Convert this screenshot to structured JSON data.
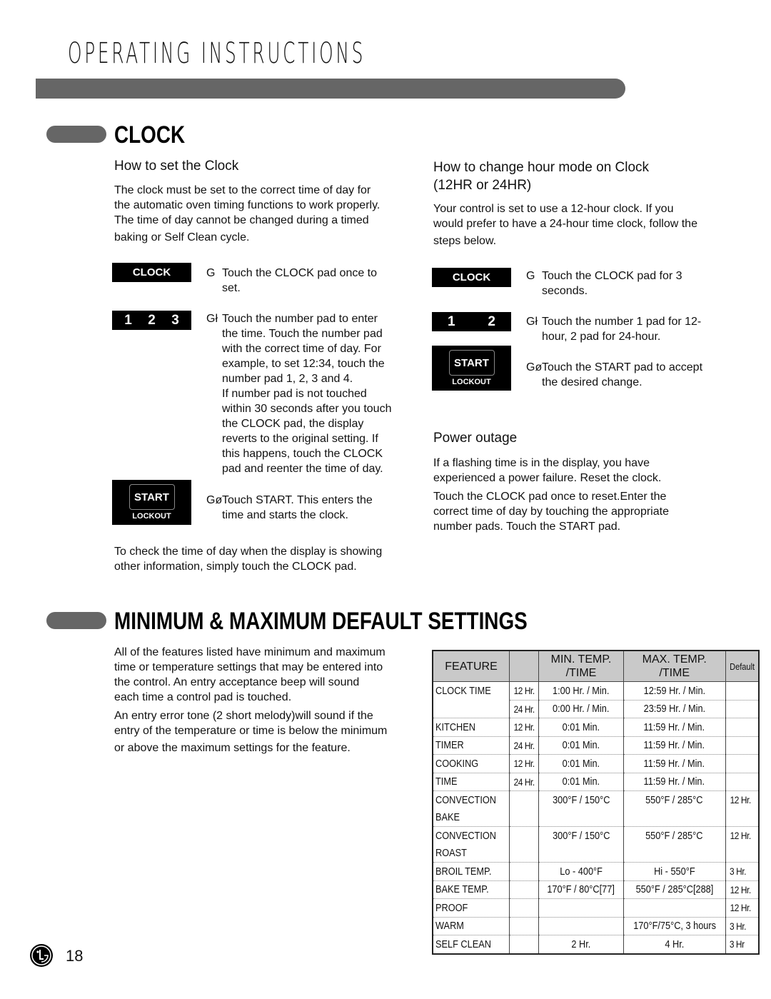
{
  "header": {
    "title": "OPERATING INSTRUCTIONS"
  },
  "clock_section": {
    "title": "CLOCK",
    "set_clock": {
      "heading": "How to set the Clock",
      "intro": [
        "The clock must be set to the correct time of day for",
        "the automatic oven timing functions to work properly.",
        "The time of day cannot be changed during a timed",
        "baking or Self Clean cycle."
      ],
      "pads": {
        "clock": "CLOCK",
        "numbers": [
          "1",
          "2",
          "3"
        ],
        "start": "START",
        "lockout": "LOCKOUT"
      },
      "steps": [
        {
          "marker": "G",
          "lines": [
            "Touch the CLOCK pad once to",
            "set."
          ]
        },
        {
          "marker": "Gł",
          "lines": [
            "Touch the number  pad to enter",
            "the time. Touch the number pad",
            "with the correct time of day. For",
            "example, to set 12:34, touch the",
            "number pad 1, 2, 3 and 4.",
            "If number pad is not touched",
            "within 30 seconds after you touch",
            "the CLOCK pad, the display",
            "reverts to the original setting. If",
            "this happens, touch the CLOCK",
            "pad and reenter the time of day."
          ]
        },
        {
          "marker": "Gø",
          "lines": [
            "Touch START. This enters the",
            "time and starts the clock."
          ]
        }
      ],
      "footer": [
        "To check the time of day when the display is showing",
        "other information, simply touch the CLOCK pad."
      ]
    },
    "hour_mode": {
      "heading_lines": [
        "How to change hour mode on Clock",
        "(12HR or 24HR)"
      ],
      "intro": [
        "Your control is set to use a 12-hour clock. If you",
        "would prefer to have a 24-hour time clock, follow the",
        "steps below."
      ],
      "pads": {
        "clock": "CLOCK",
        "numbers": [
          "1",
          "2"
        ],
        "start": "START",
        "lockout": "LOCKOUT"
      },
      "steps": [
        {
          "marker": "G",
          "lines": [
            "Touch the CLOCK pad for 3",
            "seconds."
          ]
        },
        {
          "marker": "Gł",
          "lines": [
            "Touch the number 1 pad for 12-",
            "hour, 2 pad for 24-hour."
          ]
        },
        {
          "marker": "Gø",
          "lines": [
            "Touch the START pad to accept",
            "the desired change."
          ]
        }
      ]
    },
    "power_outage": {
      "heading": "Power outage",
      "para1": [
        "If a flashing time is in the display, you have",
        "experienced a power failure. Reset the clock."
      ],
      "para2": [
        "Touch the CLOCK pad once to reset.Enter the",
        "correct time of day by touching the appropriate",
        "number pads. Touch the START pad."
      ]
    }
  },
  "defaults_section": {
    "title": "MINIMUM & MAXIMUM DEFAULT SETTINGS",
    "para1": [
      "All of the features listed have minimum and maximum",
      "time or temperature settings that may be entered into",
      "the control. An entry acceptance beep will sound",
      "each time a control pad is touched."
    ],
    "para2": [
      "An entry error tone (2 short melody)will sound if the",
      "entry of the temperature or time is below the minimum",
      "or above the maximum settings for the feature."
    ],
    "table": {
      "headers": {
        "feature": "FEATURE",
        "mode": "",
        "min_line1": "MIN. TEMP.",
        "min_line2": "/TIME",
        "max_line1": "MAX. TEMP.",
        "max_line2": "/TIME",
        "default": "Default"
      },
      "rows": [
        {
          "feature": "CLOCK TIME",
          "mode": "12 Hr.",
          "min": "1:00 Hr. / Min.",
          "max": "12:59 Hr. / Min.",
          "default": ""
        },
        {
          "feature": "",
          "mode": "24 Hr.",
          "min": "0:00 Hr. / Min.",
          "max": "23:59 Hr. / Min.",
          "default": ""
        },
        {
          "feature": "KITCHEN",
          "mode": "12 Hr.",
          "min": "0:01 Min.",
          "max": "11:59 Hr. / Min.",
          "default": ""
        },
        {
          "feature": "TIMER",
          "mode": "24 Hr.",
          "min": "0:01 Min.",
          "max": "11:59 Hr. / Min.",
          "default": ""
        },
        {
          "feature": "COOKING",
          "mode": "12 Hr.",
          "min": "0:01 Min.",
          "max": "11:59 Hr. / Min.",
          "default": ""
        },
        {
          "feature": "TIME",
          "mode": "24 Hr.",
          "min": "0:01 Min.",
          "max": "11:59 Hr. / Min.",
          "default": ""
        },
        {
          "feature": "CONVECTION",
          "mode": "",
          "min": "300°F / 150°C",
          "max": "550°F / 285°C",
          "default": "12 Hr."
        },
        {
          "feature": "BAKE",
          "mode": "",
          "min": "",
          "max": "",
          "default": ""
        },
        {
          "feature": "CONVECTION",
          "mode": "",
          "min": "300°F / 150°C",
          "max": "550°F / 285°C",
          "default": "12 Hr."
        },
        {
          "feature": "ROAST",
          "mode": "",
          "min": "",
          "max": "",
          "default": ""
        },
        {
          "feature": "BROIL TEMP.",
          "mode": "",
          "min": "Lo - 400°F",
          "max": "Hi - 550°F",
          "default": "3 Hr."
        },
        {
          "feature": "BAKE TEMP.",
          "mode": "",
          "min": "170°F / 80°C[77]",
          "max": "550°F / 285°C[288]",
          "default": "12 Hr."
        },
        {
          "feature": "PROOF",
          "mode": "",
          "min": "",
          "max": "",
          "default": "12 Hr."
        },
        {
          "feature": "WARM",
          "mode": "",
          "min": "",
          "max": "170°F/75°C, 3 hours",
          "default": "3 Hr."
        },
        {
          "feature": "SELF CLEAN",
          "mode": "",
          "min": "2 Hr.",
          "max": "4 Hr.",
          "default": "3 Hr"
        }
      ]
    }
  },
  "footer": {
    "logo": "LG",
    "page_number": "18"
  },
  "colors": {
    "bar_gray": "#666666",
    "header_cell_gray": "#c9c9c9",
    "pad_black": "#000000"
  }
}
